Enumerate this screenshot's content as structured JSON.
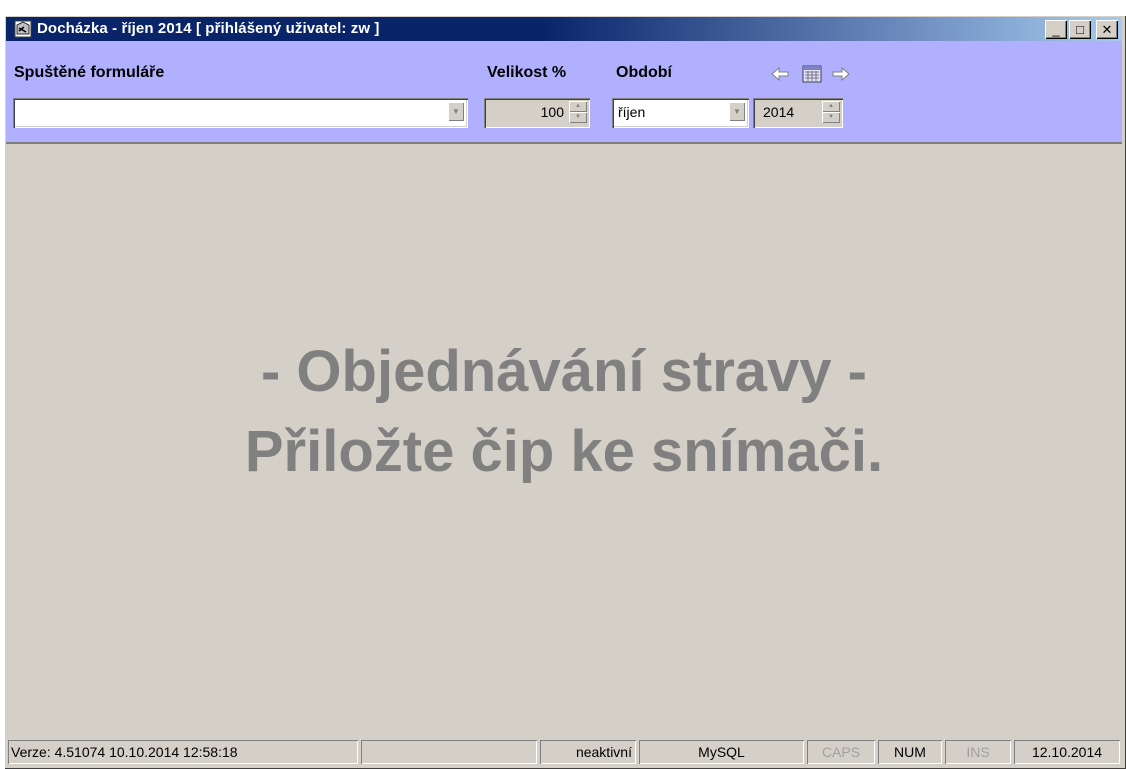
{
  "window": {
    "title": "Docházka - říjen 2014  [ přihlášený uživatel: zw ]",
    "icon": "app-icon",
    "controls": {
      "minimize": "_",
      "maximize": "□",
      "close": "✕"
    }
  },
  "toolbar": {
    "forms_label": "Spuštěné formuláře",
    "forms_value": "",
    "size_label": "Velikost %",
    "size_value": "100",
    "period_label": "Období",
    "month_value": "říjen",
    "year_value": "2014",
    "prev_icon": "arrow-left-icon",
    "calendar_icon": "calendar-icon",
    "next_icon": "arrow-right-icon",
    "background_color": "#b0b0ff"
  },
  "main": {
    "line1": "- Objednávání stravy -",
    "line2": "Přiložte čip ke snímači.",
    "text_color": "#808080"
  },
  "statusbar": {
    "version": "Verze: 4.51074    10.10.2014 12:58:18",
    "empty": "",
    "state": "neaktivní",
    "database": "MySQL",
    "caps": "CAPS",
    "num": "NUM",
    "ins": "INS",
    "date": "12.10.2014"
  }
}
